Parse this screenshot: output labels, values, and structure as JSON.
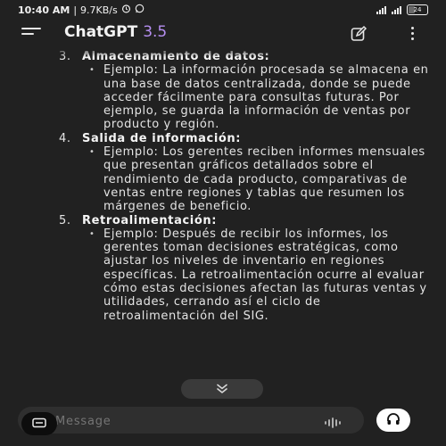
{
  "status_bar": {
    "time": "10:40 AM",
    "net_speed": "9.7KB/s",
    "battery": "24"
  },
  "header": {
    "title": "ChatGPT",
    "version": "3.5"
  },
  "items": [
    {
      "number": "3.",
      "heading": "Almacenamiento de datos:",
      "example": "Ejemplo: La información procesada se almacena en una base de datos centralizada, donde se puede acceder fácilmente para consultas futuras. Por ejemplo, se guarda la información de ventas por producto y región."
    },
    {
      "number": "4.",
      "heading": "Salida de información:",
      "example": "Ejemplo: Los gerentes reciben informes mensuales que presentan gráficos detallados sobre el rendimiento de cada producto, comparativas de ventas entre regiones y tablas que resumen los márgenes de beneficio."
    },
    {
      "number": "5.",
      "heading": "Retroalimentación:",
      "example": "Ejemplo: Después de recibir los informes, los gerentes toman decisiones estratégicas, como ajustar los niveles de inventario en regiones específicas. La retroalimentación ocurre al evaluar cómo estas decisiones afectan las futuras ventas y utilidades, cerrando así el ciclo de retroalimentación del SIG."
    }
  ],
  "composer": {
    "placeholder": "Message"
  },
  "icons": {
    "menu": "hamburger-menu-icon",
    "edit": "new-chat-icon",
    "more": "more-vertical-icon",
    "scroll": "chevron-double-down-icon",
    "attach": "attach-icon",
    "mic": "voice-waveform-icon",
    "voice_mode": "headphones-icon"
  },
  "colors": {
    "background": "#212121",
    "accent": "#b58ef0",
    "composer": "#2f2f2f"
  }
}
